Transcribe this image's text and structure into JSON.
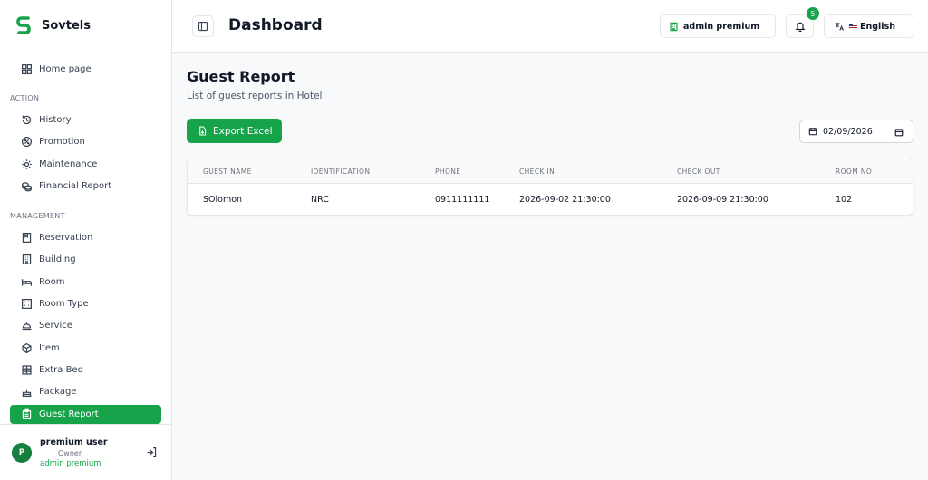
{
  "brand": {
    "name": "Sovtels",
    "color": "#16a34a"
  },
  "sidebar": {
    "home": "Home page",
    "sections": {
      "action": "ACTION",
      "management": "MANAGEMENT"
    },
    "action_items": [
      {
        "label": "History",
        "icon": "history-icon"
      },
      {
        "label": "Promotion",
        "icon": "promotion-icon"
      },
      {
        "label": "Maintenance",
        "icon": "gear-icon"
      },
      {
        "label": "Financial Report",
        "icon": "coins-icon"
      }
    ],
    "management_items": [
      {
        "label": "Reservation",
        "icon": "book-icon"
      },
      {
        "label": "Building",
        "icon": "building-icon"
      },
      {
        "label": "Room",
        "icon": "bed-icon"
      },
      {
        "label": "Room Type",
        "icon": "grid-icon"
      },
      {
        "label": "Service",
        "icon": "bell-service-icon"
      },
      {
        "label": "Item",
        "icon": "box-icon"
      },
      {
        "label": "Extra Bed",
        "icon": "table-icon"
      },
      {
        "label": "Package",
        "icon": "cake-icon"
      },
      {
        "label": "Guest Report",
        "icon": "clipboard-icon",
        "active": true
      }
    ]
  },
  "user": {
    "initial": "P",
    "name": "premium user",
    "role": "Owner",
    "org": "admin premium"
  },
  "header": {
    "title": "Dashboard",
    "org_button": "admin premium",
    "notifications": "5",
    "language": "English"
  },
  "main": {
    "title": "Guest Report",
    "subtitle": "List of guest reports in Hotel",
    "export_label": "Export Excel",
    "date_value": "02/09/2026"
  },
  "table": {
    "headers": [
      "GUEST NAME",
      "IDENTIFICATION",
      "PHONE",
      "CHECK IN",
      "CHECK OUT",
      "ROOM NO"
    ],
    "rows": [
      [
        "SOlomon",
        "NRC",
        "0911111111",
        "2026-09-02 21:30:00",
        "2026-09-09 21:30:00",
        "102"
      ]
    ]
  }
}
